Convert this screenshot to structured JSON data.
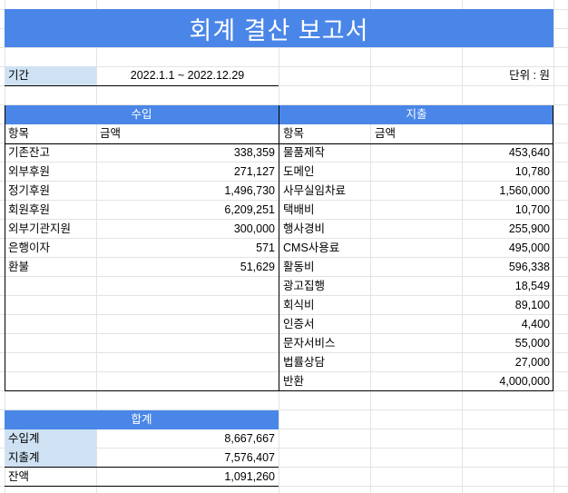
{
  "report": {
    "title": "회계 결산 보고서",
    "period_label": "기간",
    "period_value": "2022.1.1 ~ 2022.12.29",
    "unit_label": "단위 : 원"
  },
  "income": {
    "header": "수입",
    "col_item": "항목",
    "col_amount": "금액",
    "rows": [
      {
        "item": "기존잔고",
        "amount": "338,359"
      },
      {
        "item": "외부후원",
        "amount": "271,127"
      },
      {
        "item": "정기후원",
        "amount": "1,496,730"
      },
      {
        "item": "회원후원",
        "amount": "6,209,251"
      },
      {
        "item": "외부기관지원",
        "amount": "300,000"
      },
      {
        "item": "은행이자",
        "amount": "571"
      },
      {
        "item": "환불",
        "amount": "51,629"
      }
    ]
  },
  "expense": {
    "header": "지출",
    "col_item": "항목",
    "col_amount": "금액",
    "rows": [
      {
        "item": "물품제작",
        "amount": "453,640"
      },
      {
        "item": "도메인",
        "amount": "10,780"
      },
      {
        "item": "사무실임차료",
        "amount": "1,560,000"
      },
      {
        "item": "택배비",
        "amount": "10,700"
      },
      {
        "item": "행사경비",
        "amount": "255,900"
      },
      {
        "item": "CMS사용료",
        "amount": "495,000"
      },
      {
        "item": "활동비",
        "amount": "596,338"
      },
      {
        "item": "광고집행",
        "amount": "18,549"
      },
      {
        "item": "회식비",
        "amount": "89,100"
      },
      {
        "item": "인증서",
        "amount": "4,400"
      },
      {
        "item": "문자서비스",
        "amount": "55,000"
      },
      {
        "item": "법률상담",
        "amount": "27,000"
      },
      {
        "item": "반환",
        "amount": "4,000,000"
      }
    ]
  },
  "totals": {
    "header": "합계",
    "rows": [
      {
        "label": "수입계",
        "amount": "8,667,667"
      },
      {
        "label": "지출계",
        "amount": "7,576,407"
      },
      {
        "label": "잔액",
        "amount": "1,091,260"
      }
    ]
  },
  "colors": {
    "header_blue": "#4a86e8",
    "label_light_blue": "#cfe2f3",
    "gridline": "#e2e3e3"
  }
}
